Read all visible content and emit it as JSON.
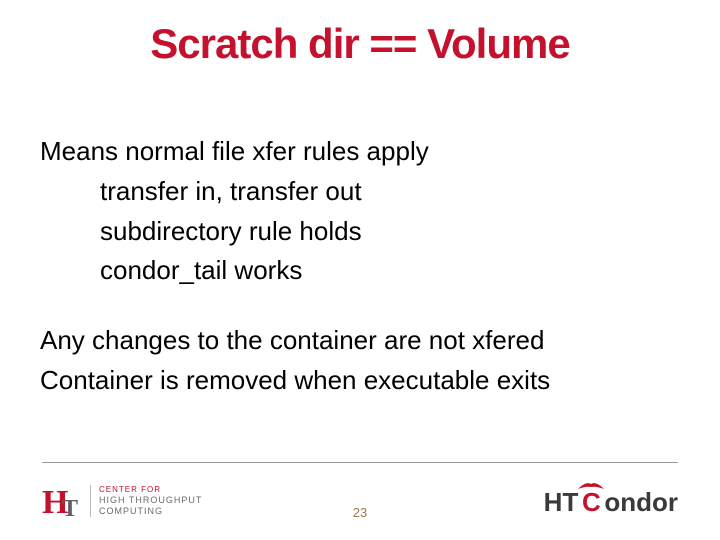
{
  "title": "Scratch dir == Volume",
  "body": {
    "line1": "Means normal file xfer rules apply",
    "indent1": "transfer in, transfer out",
    "indent2": "subdirectory rule holds",
    "indent3": "condor_tail works",
    "line2": "Any changes to the container are not xfered",
    "line3": "Container is removed when executable exits"
  },
  "page_number": "23",
  "logo_left": {
    "mark_h": "H",
    "mark_t": "T",
    "line1": "CENTER FOR",
    "line2": "HIGH THROUGHPUT",
    "line3": "COMPUTING"
  },
  "logo_right": {
    "ht": "HT",
    "c": "C",
    "ondor": "ondor"
  }
}
